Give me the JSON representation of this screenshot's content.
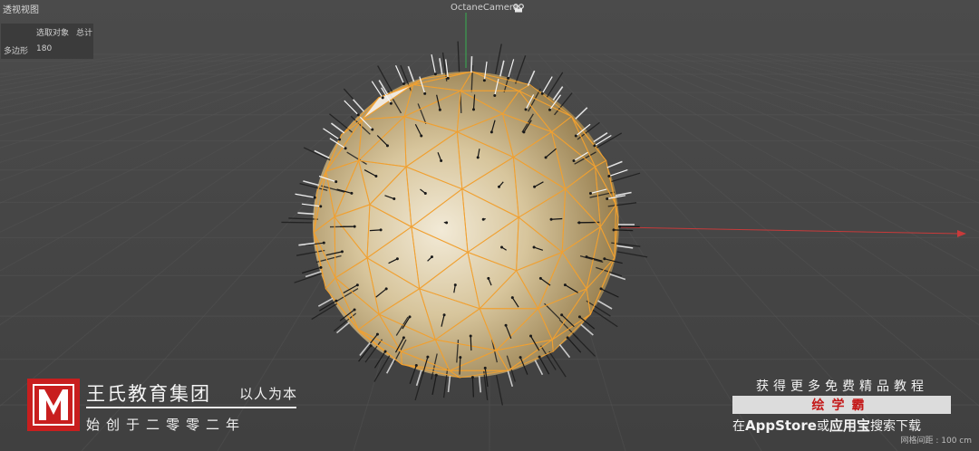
{
  "viewport": {
    "title": "透视视图",
    "camera": "OctaneCamera",
    "grid_distance": "网格间距 : 100 cm"
  },
  "stats": {
    "col_selected": "选取对象",
    "col_total": "总计",
    "row_label": "多边形",
    "row_value": "180"
  },
  "watermark": {
    "org_name": "王氏教育集团",
    "slogan": "以人为本",
    "founded": "始创于二零零二年"
  },
  "promo": {
    "title": "获得更多免费精品教程",
    "brand": "绘学霸",
    "line_prefix": "在",
    "store1": "AppStore",
    "or": "或",
    "store2": "应用宝",
    "line_suffix": "搜索下载"
  },
  "colors": {
    "sphere_edge": "#f0a030",
    "axis_x": "#c83a3a",
    "axis_y": "#3ca050",
    "promo_brand": "#c41818"
  },
  "icons": {
    "camera": "camera-icon",
    "logo": "w-logo-icon"
  }
}
